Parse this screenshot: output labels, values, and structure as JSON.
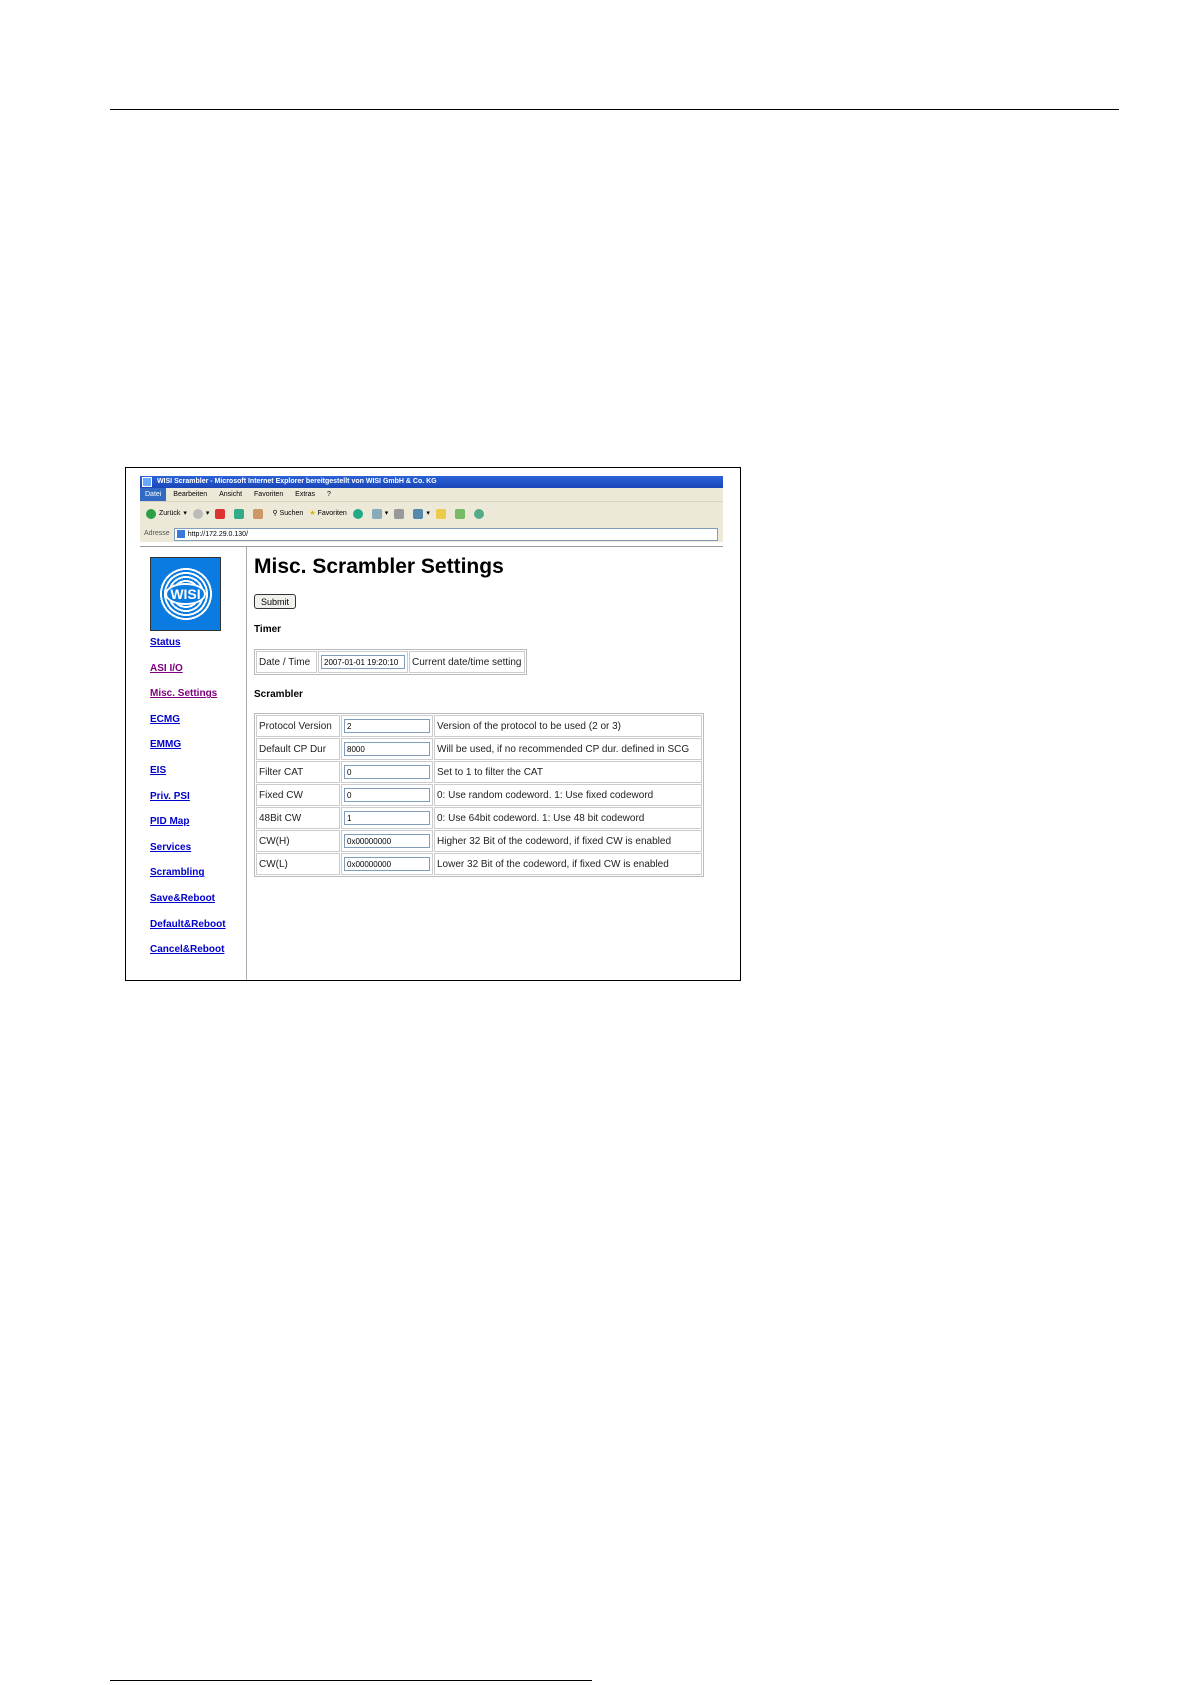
{
  "window": {
    "title": "WISI Scrambler - Microsoft Internet Explorer bereitgestellt von WISI GmbH & Co. KG"
  },
  "menu": [
    "Datei",
    "Bearbeiten",
    "Ansicht",
    "Favoriten",
    "Extras",
    "?"
  ],
  "toolbar": {
    "back_label": "Zurück",
    "search_label": "Suchen",
    "favorites_label": "Favoriten"
  },
  "address": {
    "label": "Adresse",
    "url": "http://172.29.0.130/"
  },
  "sidebar": {
    "logo_text": "WISI",
    "items": [
      {
        "label": "Status",
        "visited": false
      },
      {
        "label": "ASI I/O",
        "visited": true
      },
      {
        "label": "Misc. Settings",
        "visited": true
      },
      {
        "label": "ECMG",
        "visited": false
      },
      {
        "label": "EMMG",
        "visited": false
      },
      {
        "label": "EIS",
        "visited": false
      },
      {
        "label": "Priv. PSI",
        "visited": false
      },
      {
        "label": "PID Map",
        "visited": false
      },
      {
        "label": "Services",
        "visited": false
      },
      {
        "label": "Scrambling",
        "visited": false
      },
      {
        "label": "Save&Reboot",
        "visited": false
      },
      {
        "label": "Default&Reboot",
        "visited": false
      },
      {
        "label": "Cancel&Reboot",
        "visited": false
      }
    ]
  },
  "main": {
    "title": "Misc. Scrambler Settings",
    "submit_label": "Submit",
    "timer": {
      "heading": "Timer",
      "label": "Date / Time",
      "value": "2007-01-01 19:20:10",
      "description": "Current date/time setting"
    },
    "scrambler": {
      "heading": "Scrambler",
      "rows": [
        {
          "label": "Protocol Version",
          "value": "2",
          "description": "Version of the protocol to be used (2 or 3)"
        },
        {
          "label": "Default CP Dur",
          "value": "8000",
          "description": "Will be used, if no recommended CP dur. defined in SCG"
        },
        {
          "label": "Filter CAT",
          "value": "0",
          "description": "Set to 1 to filter the CAT"
        },
        {
          "label": "Fixed CW",
          "value": "0",
          "description": "0: Use random codeword. 1: Use fixed codeword"
        },
        {
          "label": "48Bit CW",
          "value": "1",
          "description": "0: Use 64bit codeword. 1: Use 48 bit codeword"
        },
        {
          "label": "CW(H)",
          "value": "0x00000000",
          "description": "Higher 32 Bit of the codeword, if fixed CW is enabled"
        },
        {
          "label": "CW(L)",
          "value": "0x00000000",
          "description": "Lower 32 Bit of the codeword, if fixed CW is enabled"
        }
      ]
    }
  },
  "colors": {
    "link": "#0000cc",
    "visited_link": "#800080",
    "logo_blue": "#0a7be0",
    "titlebar_blue": "#2b62d8"
  }
}
